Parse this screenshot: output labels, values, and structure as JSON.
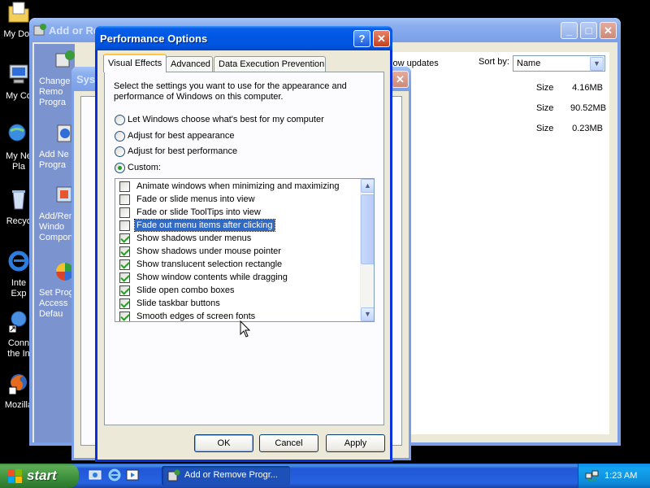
{
  "desktop": {
    "icons": [
      {
        "label": "My Doc",
        "icon": "folder-documents-icon"
      },
      {
        "label": "My Co",
        "icon": "computer-icon"
      },
      {
        "label": "My Ne",
        "label2": "Pla",
        "icon": "network-places-icon"
      },
      {
        "label": "Recyc",
        "icon": "recycle-bin-icon"
      },
      {
        "label": "Inte",
        "label2": "Exp",
        "icon": "internet-explorer-icon"
      },
      {
        "label": "Conn",
        "label2": "the In",
        "icon": "connect-internet-icon"
      },
      {
        "label": "Mozilla",
        "icon": "firefox-icon"
      }
    ]
  },
  "arp_window": {
    "title": "Add or Re",
    "sidebar": [
      {
        "label": "Change",
        "label2": "Remo",
        "label3": "Progra",
        "icon": "change-remove-programs-icon"
      },
      {
        "label": "Add Ne",
        "label2": "Progra",
        "icon": "add-programs-icon"
      },
      {
        "label": "Add/Rem",
        "label2": "Windo",
        "label3": "Compon",
        "icon": "windows-components-icon"
      },
      {
        "label": "Set Prog",
        "label2": "Access",
        "label3": "Defau",
        "icon": "program-defaults-icon"
      }
    ],
    "show_updates": "Show updates",
    "sort_by_label": "Sort by:",
    "sort_by_value": "Name",
    "rows": [
      {
        "size_label": "Size",
        "size": "4.16MB"
      },
      {
        "size_label": "Size",
        "size": "90.52MB"
      },
      {
        "size_label": "Size",
        "size": "0.23MB"
      }
    ]
  },
  "sys_window": {
    "title": "Syst"
  },
  "perf_dialog": {
    "title": "Performance Options",
    "tabs": [
      "Visual Effects",
      "Advanced",
      "Data Execution Prevention"
    ],
    "selected_tab": 0,
    "description": "Select the settings you want to use for the appearance and performance of Windows on this computer.",
    "options": [
      {
        "label": "Let Windows choose what's best for my computer",
        "selected": false
      },
      {
        "label": "Adjust for best appearance",
        "selected": false
      },
      {
        "label": "Adjust for best performance",
        "selected": false
      },
      {
        "label": "Custom:",
        "selected": true
      }
    ],
    "effects": [
      {
        "label": "Animate windows when minimizing and maximizing",
        "checked": false
      },
      {
        "label": "Fade or slide menus into view",
        "checked": false
      },
      {
        "label": "Fade or slide ToolTips into view",
        "checked": false
      },
      {
        "label": "Fade out menu items after clicking",
        "checked": false,
        "highlighted": true
      },
      {
        "label": "Show shadows under menus",
        "checked": true
      },
      {
        "label": "Show shadows under mouse pointer",
        "checked": true
      },
      {
        "label": "Show translucent selection rectangle",
        "checked": true
      },
      {
        "label": "Show window contents while dragging",
        "checked": true
      },
      {
        "label": "Slide open combo boxes",
        "checked": true
      },
      {
        "label": "Slide taskbar buttons",
        "checked": true
      },
      {
        "label": "Smooth edges of screen fonts",
        "checked": true
      }
    ],
    "buttons": {
      "ok": "OK",
      "cancel": "Cancel",
      "apply": "Apply"
    },
    "help_glyph": "?",
    "close_glyph": "✕"
  },
  "taskbar": {
    "start_label": "start",
    "task_button": "Add or Remove Progr...",
    "clock": "1:23 AM",
    "quicklaunch": [
      "show-desktop-icon",
      "internet-explorer-icon",
      "windows-media-player-icon"
    ]
  },
  "colors": {
    "titlebar": "#0058e6",
    "dialog_face": "#ece9d8",
    "selection": "#316ac5",
    "start_green": "#3c8f3c"
  }
}
